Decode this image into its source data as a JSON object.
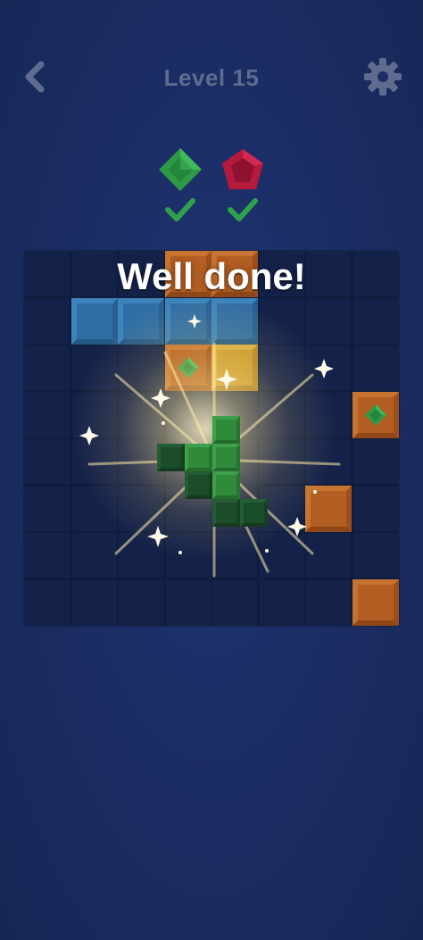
{
  "header": {
    "title": "Level 15",
    "back_icon": "chevron-left-icon",
    "settings_icon": "gear-icon"
  },
  "goals": [
    {
      "gem": "green-diamond-gem",
      "color": "#2e9a45",
      "status": "complete"
    },
    {
      "gem": "red-pentagon-gem",
      "color": "#b5193c",
      "status": "complete"
    }
  ],
  "board": {
    "rows": 8,
    "cols": 8
  },
  "banner": {
    "text": "Well done!"
  },
  "colors": {
    "background": "#1a2c62",
    "check": "#2fa14a",
    "title": "#5f6b8f"
  }
}
